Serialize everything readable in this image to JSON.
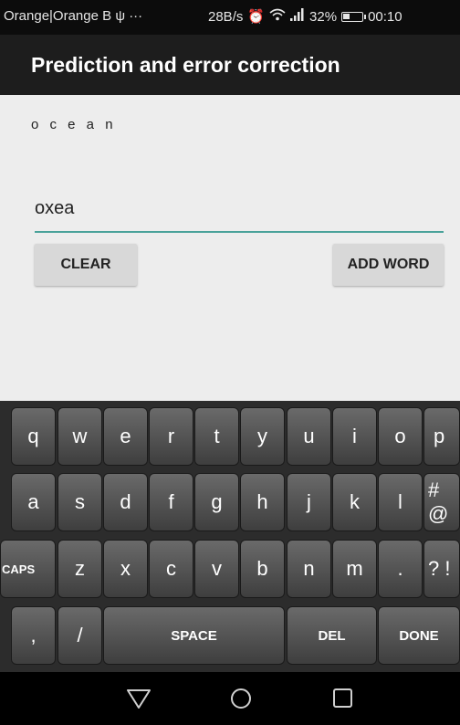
{
  "status_bar": {
    "carrier": "Orange|Orange B",
    "usb_icon": "usb-icon",
    "more": "···",
    "speed": "28B/s",
    "signal_text": "..ıl",
    "battery_pct": "32%",
    "time": "00:10"
  },
  "app": {
    "title": "Prediction and error correction"
  },
  "prediction": {
    "text": "o c e a n"
  },
  "input": {
    "value": "oxea"
  },
  "buttons": {
    "clear": "CLEAR",
    "add_word": "ADD WORD"
  },
  "keyboard": {
    "row1": [
      "q",
      "w",
      "e",
      "r",
      "t",
      "y",
      "u",
      "i",
      "o",
      "p"
    ],
    "row2": [
      "a",
      "s",
      "d",
      "f",
      "g",
      "h",
      "j",
      "k",
      "l",
      "# @"
    ],
    "row3": [
      "CAPS",
      "z",
      "x",
      "c",
      "v",
      "b",
      "n",
      "m",
      ".",
      "? !"
    ],
    "row4": [
      ",",
      "/",
      "SPACE",
      "DEL",
      "DONE"
    ]
  },
  "navbar": {
    "back_icon": "back-triangle-icon",
    "home_icon": "home-circle-icon",
    "recents_icon": "recents-square-icon"
  }
}
